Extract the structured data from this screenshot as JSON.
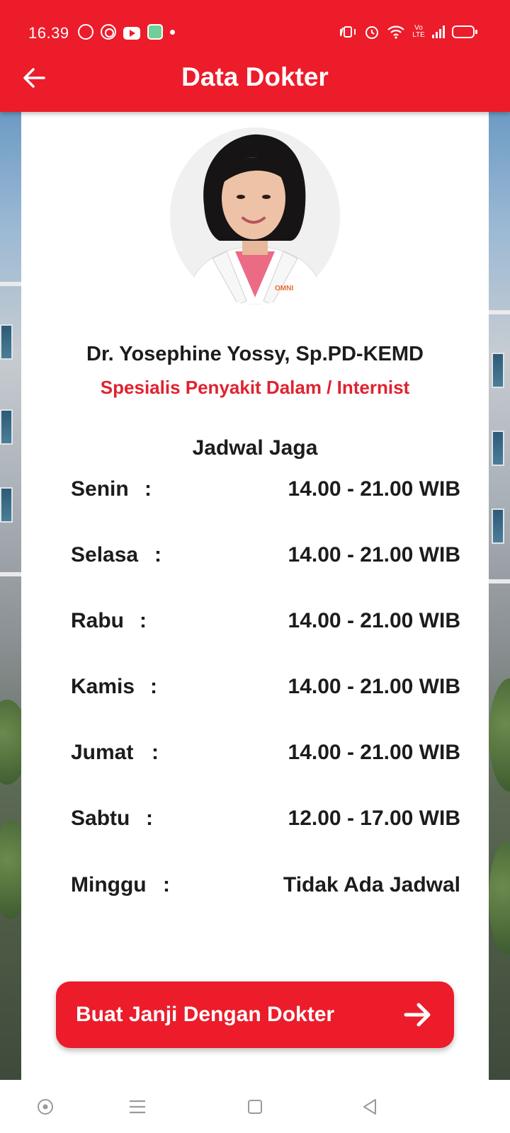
{
  "status_bar": {
    "time": "16.39",
    "left_icons": [
      "whatsapp-icon",
      "chat-ring-icon",
      "youtube-icon",
      "app-icon",
      "notification-dot-icon"
    ],
    "right_icons": [
      "vibrate-icon",
      "alarm-icon",
      "wifi-icon",
      "volte-icon",
      "signal-icon",
      "battery-icon"
    ],
    "volte_text": "Vo LTE"
  },
  "app_bar": {
    "title": "Data Dokter",
    "back_icon": "arrow-left-icon"
  },
  "doctor": {
    "name": "Dr. Yosephine Yossy, Sp.PD-KEMD",
    "specialty": "Spesialis Penyakit Dalam / Internist",
    "coat_logo": "OMNI"
  },
  "schedule": {
    "title": "Jadwal Jaga",
    "separator": ":",
    "rows": [
      {
        "day": "Senin",
        "time": "14.00 - 21.00 WIB"
      },
      {
        "day": "Selasa",
        "time": "14.00 - 21.00 WIB"
      },
      {
        "day": "Rabu",
        "time": "14.00 - 21.00 WIB"
      },
      {
        "day": "Kamis",
        "time": "14.00 - 21.00 WIB"
      },
      {
        "day": "Jumat",
        "time": "14.00 - 21.00 WIB"
      },
      {
        "day": "Sabtu",
        "time": "12.00 - 17.00 WIB"
      },
      {
        "day": "Minggu",
        "time": "Tidak Ada Jadwal"
      }
    ]
  },
  "cta": {
    "label": "Buat Janji Dengan Dokter",
    "icon": "arrow-right-icon"
  },
  "nav_bar": {
    "icons": [
      "assistant-icon",
      "menu-icon",
      "home-square-icon",
      "back-triangle-icon"
    ]
  },
  "colors": {
    "primary": "#ec1c2b",
    "specialty_text": "#e02230",
    "text": "#1c1c1c"
  }
}
